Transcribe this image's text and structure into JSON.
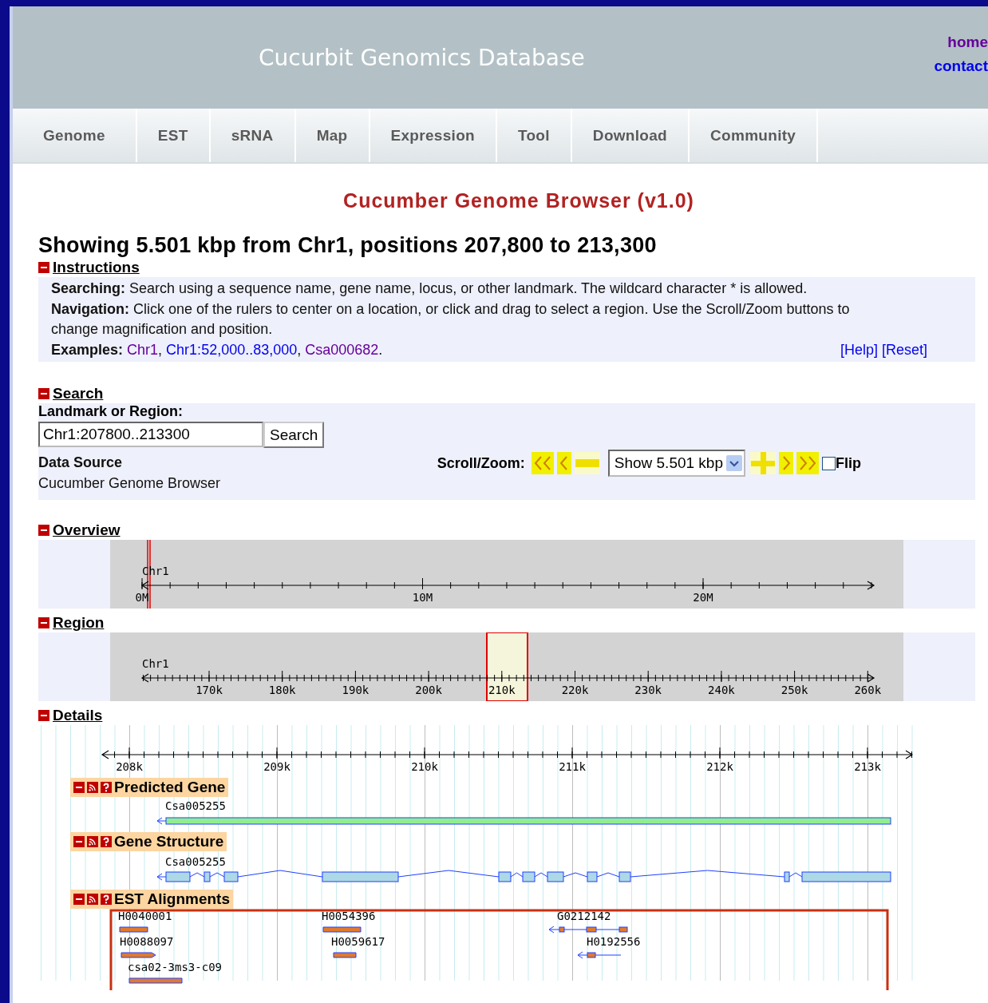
{
  "site": {
    "title": "Cucurbit Genomics Database",
    "links": [
      {
        "label": "home",
        "visited": true
      },
      {
        "label": "contact",
        "visited": false
      }
    ]
  },
  "nav": [
    "Genome",
    "EST",
    "sRNA",
    "Map",
    "Expression",
    "Tool",
    "Download",
    "Community"
  ],
  "page_title": "Cucumber Genome Browser (v1.0)",
  "heading": "Showing 5.501 kbp from Chr1, positions 207,800 to 213,300",
  "instructions": {
    "title": "Instructions",
    "expanded": true,
    "paragraphs": [
      {
        "label": "Searching:",
        "text": "Search using a sequence name, gene name, locus, or other landmark. The wildcard character * is allowed."
      },
      {
        "label": "Navigation:",
        "text": "Click one of the rulers to center on a location, or click and drag to select a region. Use the Scroll/Zoom buttons to change magnification and position."
      }
    ],
    "examples_label": "Examples:",
    "examples": [
      {
        "text": "Chr1",
        "visited": true,
        "suffix": ","
      },
      {
        "text": "Chr1:52,000..83,000",
        "visited": false,
        "suffix": ","
      },
      {
        "text": "Csa000682",
        "visited": true,
        "suffix": "."
      }
    ],
    "help_links": [
      "[Help]",
      "[Reset]"
    ]
  },
  "search": {
    "title": "Search",
    "expanded": true,
    "field_label": "Landmark or Region:",
    "value": "Chr1:207800..213300",
    "button": "Search",
    "source_label": "Data Source",
    "source": "Cucumber Genome Browser",
    "scroll_label": "Scroll/Zoom:",
    "zoom": "Show 5.501 kbp",
    "flip": {
      "label": "Flip",
      "checked": false
    }
  },
  "overview": {
    "title": "Overview",
    "expanded": true,
    "chromosome": "Chr1",
    "ticks": [
      "0M",
      "10M",
      "20M"
    ]
  },
  "region": {
    "title": "Region",
    "expanded": true,
    "chromosome": "Chr1",
    "ticks": [
      "170k",
      "180k",
      "190k",
      "200k",
      "210k",
      "220k",
      "230k",
      "240k",
      "250k",
      "260k"
    ]
  },
  "details": {
    "title": "Details",
    "expanded": true,
    "ticks": [
      "208k",
      "209k",
      "210k",
      "211k",
      "212k",
      "213k"
    ],
    "tracks": [
      {
        "title": "Predicted Gene",
        "kind": "gene",
        "features": [
          "Csa005255"
        ]
      },
      {
        "title": "Gene Structure",
        "kind": "structure",
        "features": [
          "Csa005255"
        ]
      },
      {
        "title": "EST Alignments",
        "kind": "est",
        "features": [
          "H0040001",
          "H0088097",
          "csa02-3ms3-c09",
          "H0054396",
          "H0059617",
          "G0212142",
          "H0192556"
        ]
      }
    ]
  }
}
